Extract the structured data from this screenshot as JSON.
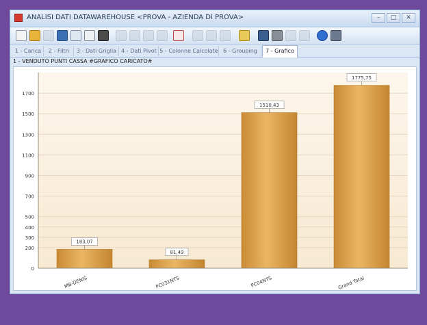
{
  "window": {
    "title": "ANALISI DATI DATAWAREHOUSE <PROVA - AZIENDA DI PROVA>",
    "controls": {
      "minimize": "–",
      "restore": "□",
      "close": "✕"
    }
  },
  "tabs": [
    {
      "label": "1 - Carica"
    },
    {
      "label": "2 - Filtri"
    },
    {
      "label": "3 - Dati Griglia"
    },
    {
      "label": "4 - Dati Pivot"
    },
    {
      "label": "5 - Colonne Calcolate"
    },
    {
      "label": "6 - Grouping"
    },
    {
      "label": "7 - Grafico"
    }
  ],
  "breadcrumb": "1 - VENDUTO PUNTI CASSA  #GRAFICO CARICATO#",
  "colors": {
    "bar": "#e0a54e",
    "bar_dark": "#c4852f",
    "plot_bg": "#fdf4e7",
    "accent": "#d63a2e"
  },
  "chart_data": {
    "type": "bar",
    "categories": [
      "MB-DENIS",
      "PC031NTS",
      "PC04NTS",
      "Grand Total"
    ],
    "values": [
      183.07,
      81.49,
      1510.43,
      1775.75
    ],
    "value_labels": [
      "183,07",
      "81,49",
      "1510,43",
      "1775,75"
    ],
    "ylim": [
      0,
      1900
    ],
    "yticks": [
      0,
      200,
      300,
      400,
      500,
      700,
      900,
      1100,
      1300,
      1500,
      1700
    ],
    "grid": true
  }
}
